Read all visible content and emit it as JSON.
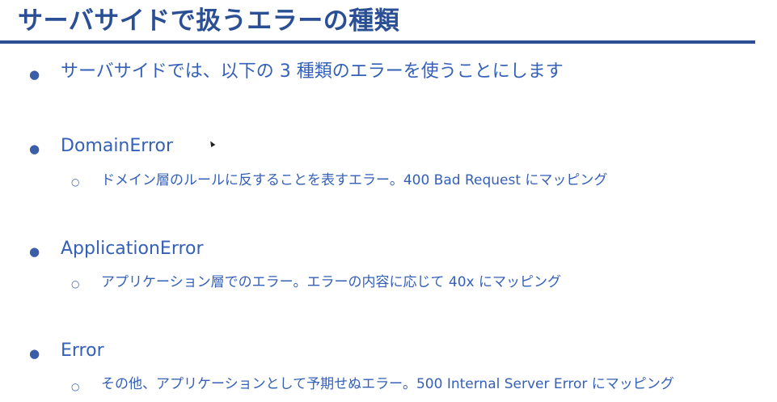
{
  "slide": {
    "title": "サーバサイドで扱うエラーの種類",
    "bullet_glyph": "●",
    "sub_bullet_glyph": "○",
    "intro": "サーバサイドでは、以下の 3 種類のエラーを使うことにします",
    "items": [
      {
        "name": "DomainError",
        "detail": "ドメイン層のルールに反することを表すエラー。400 Bad Request にマッピング"
      },
      {
        "name": "ApplicationError",
        "detail": "アプリケーション層でのエラー。エラーの内容に応じて 40x にマッピング"
      },
      {
        "name": "Error",
        "detail": "その他、アプリケーションとして予期せぬエラー。500 Internal Server Error にマッピング"
      }
    ]
  },
  "colors": {
    "title": "#2b4f95",
    "body_text": "#3560b8",
    "background": "#ffffff"
  }
}
